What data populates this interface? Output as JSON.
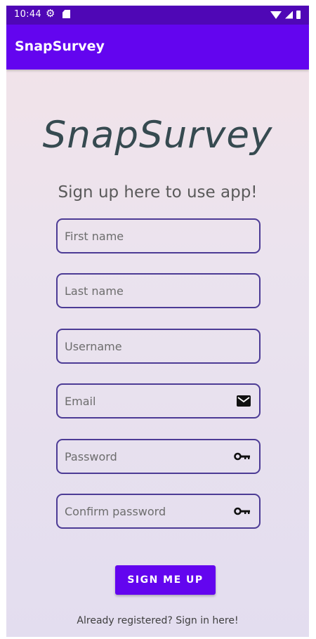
{
  "status_bar": {
    "time": "10:44",
    "icons": [
      "settings-gear-icon",
      "sd-card-icon",
      "wifi-icon",
      "cell-signal-icon",
      "battery-icon"
    ]
  },
  "app_bar": {
    "title": "SnapSurvey",
    "color": "#6305ef"
  },
  "logo_text": "SnapSurvey",
  "subtitle": "Sign up here to use app!",
  "form": {
    "first_name": {
      "placeholder": "First name",
      "value": ""
    },
    "last_name": {
      "placeholder": "Last name",
      "value": ""
    },
    "username": {
      "placeholder": "Username",
      "value": ""
    },
    "email": {
      "placeholder": "Email",
      "value": "",
      "icon": "email-icon"
    },
    "password": {
      "placeholder": "Password",
      "value": "",
      "icon": "key-icon"
    },
    "confirm_password": {
      "placeholder": "Confirm password",
      "value": "",
      "icon": "key-icon"
    }
  },
  "signup_button": "SIGN ME UP",
  "signin_link": "Already registered? Sign in here!",
  "colors": {
    "accent": "#6305ef",
    "status_bar": "#4f07b6",
    "field_border": "#4c3b95",
    "logo": "#364a50"
  }
}
